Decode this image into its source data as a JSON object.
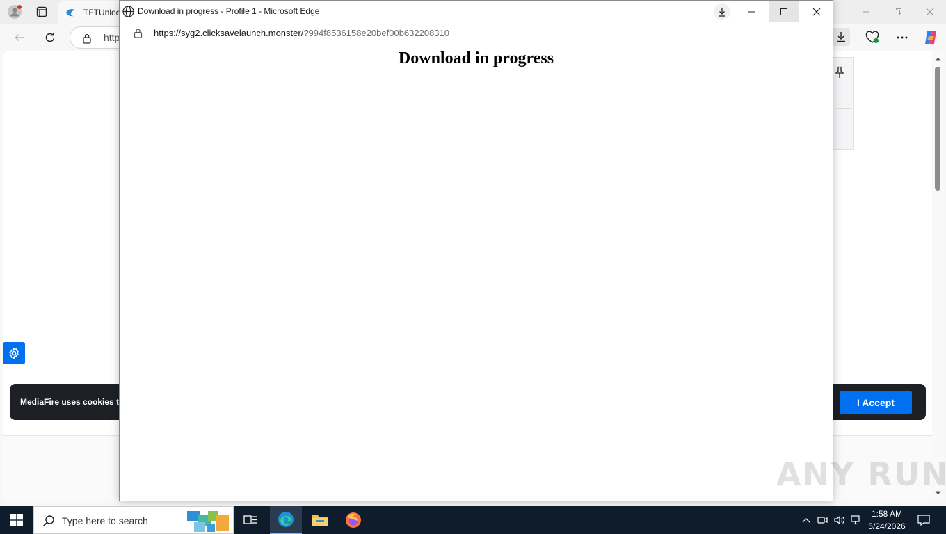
{
  "background_window": {
    "tab_title": "TFTUnlock",
    "address_partial": "http",
    "cookie_banner": {
      "text": "MediaFire uses cookies t",
      "accept_label": "I Accept"
    }
  },
  "popup": {
    "title": "Download in progress - Profile 1 - Microsoft Edge",
    "url_host": "https://syg2.clicksavelaunch.monster/",
    "url_rest": "?994f8536158e20bef00b632208310",
    "heading": "Download in progress"
  },
  "taskbar": {
    "search_placeholder": "Type here to search",
    "time": "1:58 AM",
    "date": "5/24/2026"
  },
  "watermark": "ANY RUN",
  "colors": {
    "accent_blue": "#0070f0",
    "banner_dark": "#1d2125",
    "taskbar": "#0f1c2b"
  }
}
